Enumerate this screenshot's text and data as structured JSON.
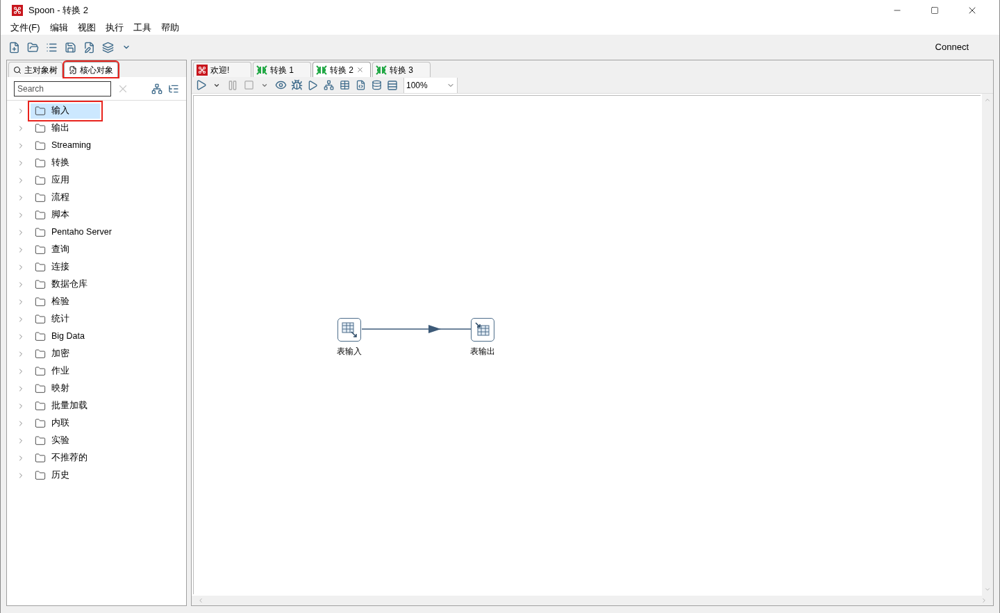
{
  "window": {
    "title": "Spoon - 转换 2"
  },
  "menu": [
    "文件(F)",
    "编辑",
    "视图",
    "执行",
    "工具",
    "帮助"
  ],
  "toolbar": {
    "connect": "Connect"
  },
  "left_tabs": [
    {
      "label": "主对象树",
      "selected": false,
      "annotated": false
    },
    {
      "label": "核心对象",
      "selected": true,
      "annotated": true
    }
  ],
  "search": {
    "placeholder": "Search"
  },
  "tree": [
    {
      "label": "输入",
      "selected": true,
      "annotated": true
    },
    {
      "label": "输出",
      "selected": false,
      "annotated": false
    },
    {
      "label": "Streaming",
      "selected": false,
      "annotated": false
    },
    {
      "label": "转换",
      "selected": false,
      "annotated": false
    },
    {
      "label": "应用",
      "selected": false,
      "annotated": false
    },
    {
      "label": "流程",
      "selected": false,
      "annotated": false
    },
    {
      "label": "脚本",
      "selected": false,
      "annotated": false
    },
    {
      "label": "Pentaho Server",
      "selected": false,
      "annotated": false
    },
    {
      "label": "查询",
      "selected": false,
      "annotated": false
    },
    {
      "label": "连接",
      "selected": false,
      "annotated": false
    },
    {
      "label": "数据仓库",
      "selected": false,
      "annotated": false
    },
    {
      "label": "检验",
      "selected": false,
      "annotated": false
    },
    {
      "label": "统计",
      "selected": false,
      "annotated": false
    },
    {
      "label": "Big Data",
      "selected": false,
      "annotated": false
    },
    {
      "label": "加密",
      "selected": false,
      "annotated": false
    },
    {
      "label": "作业",
      "selected": false,
      "annotated": false
    },
    {
      "label": "映射",
      "selected": false,
      "annotated": false
    },
    {
      "label": "批量加载",
      "selected": false,
      "annotated": false
    },
    {
      "label": "内联",
      "selected": false,
      "annotated": false
    },
    {
      "label": "实验",
      "selected": false,
      "annotated": false
    },
    {
      "label": "不推荐的",
      "selected": false,
      "annotated": false
    },
    {
      "label": "历史",
      "selected": false,
      "annotated": false
    }
  ],
  "doc_tabs": [
    {
      "label": "欢迎!",
      "kind": "welcome",
      "selected": false,
      "closable": false
    },
    {
      "label": "转换 1",
      "kind": "transformation",
      "selected": false,
      "closable": false
    },
    {
      "label": "转换 2",
      "kind": "transformation",
      "selected": true,
      "closable": true
    },
    {
      "label": "转换 3",
      "kind": "transformation",
      "selected": false,
      "closable": false
    }
  ],
  "zoom": {
    "value": "100%"
  },
  "canvas": {
    "steps": [
      {
        "label": "表输入",
        "kind": "input"
      },
      {
        "label": "表输出",
        "kind": "output"
      }
    ]
  }
}
